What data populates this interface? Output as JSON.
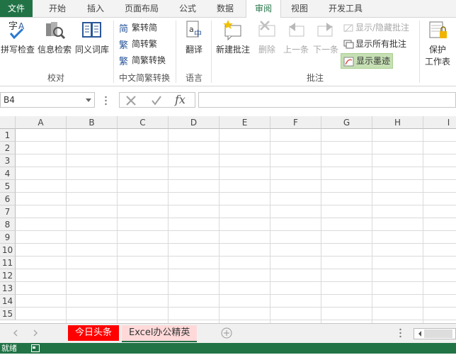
{
  "ribbon_tabs": [
    "文件",
    "开始",
    "插入",
    "页面布局",
    "公式",
    "数据",
    "审阅",
    "视图",
    "开发工具"
  ],
  "active_tab": "审阅",
  "groups": {
    "proofing": {
      "label": "校对",
      "buttons": [
        "拼写检查",
        "信息检索",
        "同义词库"
      ]
    },
    "chinese": {
      "label": "中文简繁转换",
      "buttons": [
        "繁转简",
        "简转繁",
        "简繁转换"
      ]
    },
    "language": {
      "label": "语言",
      "buttons": [
        "翻译"
      ]
    },
    "comments": {
      "label": "批注",
      "buttons": [
        "新建批注",
        "删除",
        "上一条",
        "下一条"
      ],
      "small": [
        "显示/隐藏批注",
        "显示所有批注",
        "显示墨迹"
      ]
    },
    "protect": {
      "line1": "保护",
      "line2": "工作表"
    }
  },
  "namebox": {
    "value": "B4"
  },
  "formula_bar": {
    "fx": "fx",
    "value": ""
  },
  "columns": [
    "A",
    "B",
    "C",
    "D",
    "E",
    "F",
    "G",
    "H",
    "I"
  ],
  "rows": [
    "1",
    "2",
    "3",
    "4",
    "5",
    "6",
    "7",
    "8",
    "9",
    "10",
    "11",
    "12",
    "13",
    "14",
    "15"
  ],
  "sheets": [
    {
      "name": "今日头条",
      "bg": "#ff0000",
      "color": "#ffffff"
    },
    {
      "name": "Excel办公精英",
      "bg": "#ffd9d9",
      "color": "#333333"
    }
  ],
  "status": {
    "text": "就绪"
  },
  "colors": {
    "brand": "#217346",
    "highlight": "#c6e0b4"
  }
}
